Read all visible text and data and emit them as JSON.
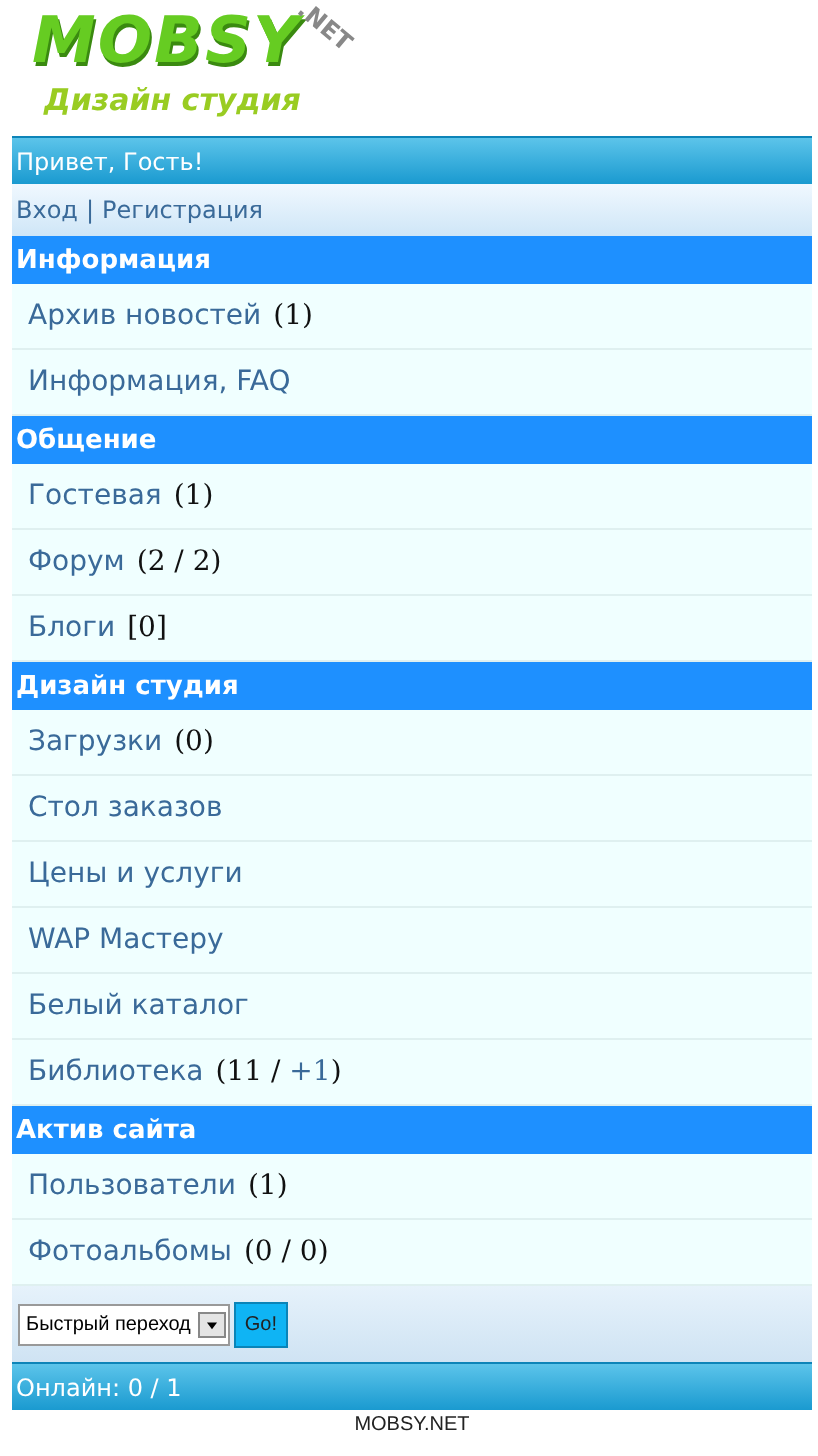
{
  "logo": {
    "name": "MOBSY",
    "suffix": ".NET",
    "tagline": "Дизайн студия"
  },
  "greeting": "Привет, Гость!",
  "auth_links": [
    {
      "label": "Вход"
    },
    {
      "label": "Регистрация"
    }
  ],
  "auth_separator": "|",
  "sections": [
    {
      "title": "Информация",
      "items": [
        {
          "label": "Архив новостей",
          "count": "(1)"
        },
        {
          "label": "Информация, FAQ"
        }
      ]
    },
    {
      "title": "Общение",
      "items": [
        {
          "label": "Гостевая",
          "count": "(1)"
        },
        {
          "label": "Форум",
          "count": "(2 / 2)"
        },
        {
          "label": "Блоги",
          "count": "[0]"
        }
      ]
    },
    {
      "title": "Дизайн студия",
      "items": [
        {
          "label": "Загрузки",
          "count": "(0)"
        },
        {
          "label": "Стол заказов"
        },
        {
          "label": "Цены и услуги"
        },
        {
          "label": "WAP Мастеру"
        },
        {
          "label": "Белый каталог"
        },
        {
          "label": "Библиотека",
          "count": "(11 / ",
          "count_link": "+1",
          "count_end": ")"
        }
      ]
    },
    {
      "title": "Актив сайта",
      "items": [
        {
          "label": "Пользователи",
          "count": "(1)"
        },
        {
          "label": "Фотоальбомы",
          "count": "(0 / 0)"
        }
      ]
    }
  ],
  "quick_jump": {
    "value": "Быстрый переход",
    "button": "Go!"
  },
  "online": "Онлайн: 0 / 1",
  "footer": "MOBSY.NET"
}
